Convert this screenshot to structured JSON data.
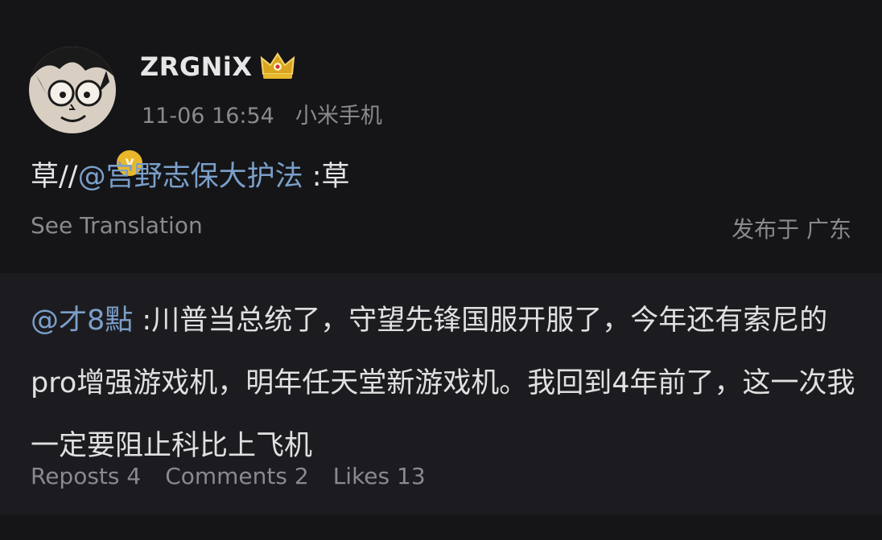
{
  "post": {
    "username": "ZRGNiX",
    "badge_letter": "v",
    "timestamp": "11-06 16:54",
    "device": "小米手机",
    "content_prefix": "草//",
    "mention": "@宫野志保大护法",
    "content_suffix": " :草",
    "see_translation": "See Translation",
    "location": "发布于 广东",
    "icons": {
      "avatar": "anime-avatar-icon",
      "verified": "verified-badge-icon",
      "crown": "crown-icon"
    }
  },
  "repost": {
    "mention": "@才8點",
    "text": " :川普当总统了，守望先锋国服开服了，今年还有索尼的pro增强游戏机，明年任天堂新游戏机。我回到4年前了，这一次我一定要阻止科比上飞机",
    "reposts": "Reposts 4",
    "comments": "Comments 2",
    "likes": "Likes 13"
  },
  "colors": {
    "background": "#151518",
    "repost_background": "#1c1c20",
    "mention": "#7b9fc9",
    "muted": "#8a8a8e",
    "badge": "#e8b72c"
  }
}
